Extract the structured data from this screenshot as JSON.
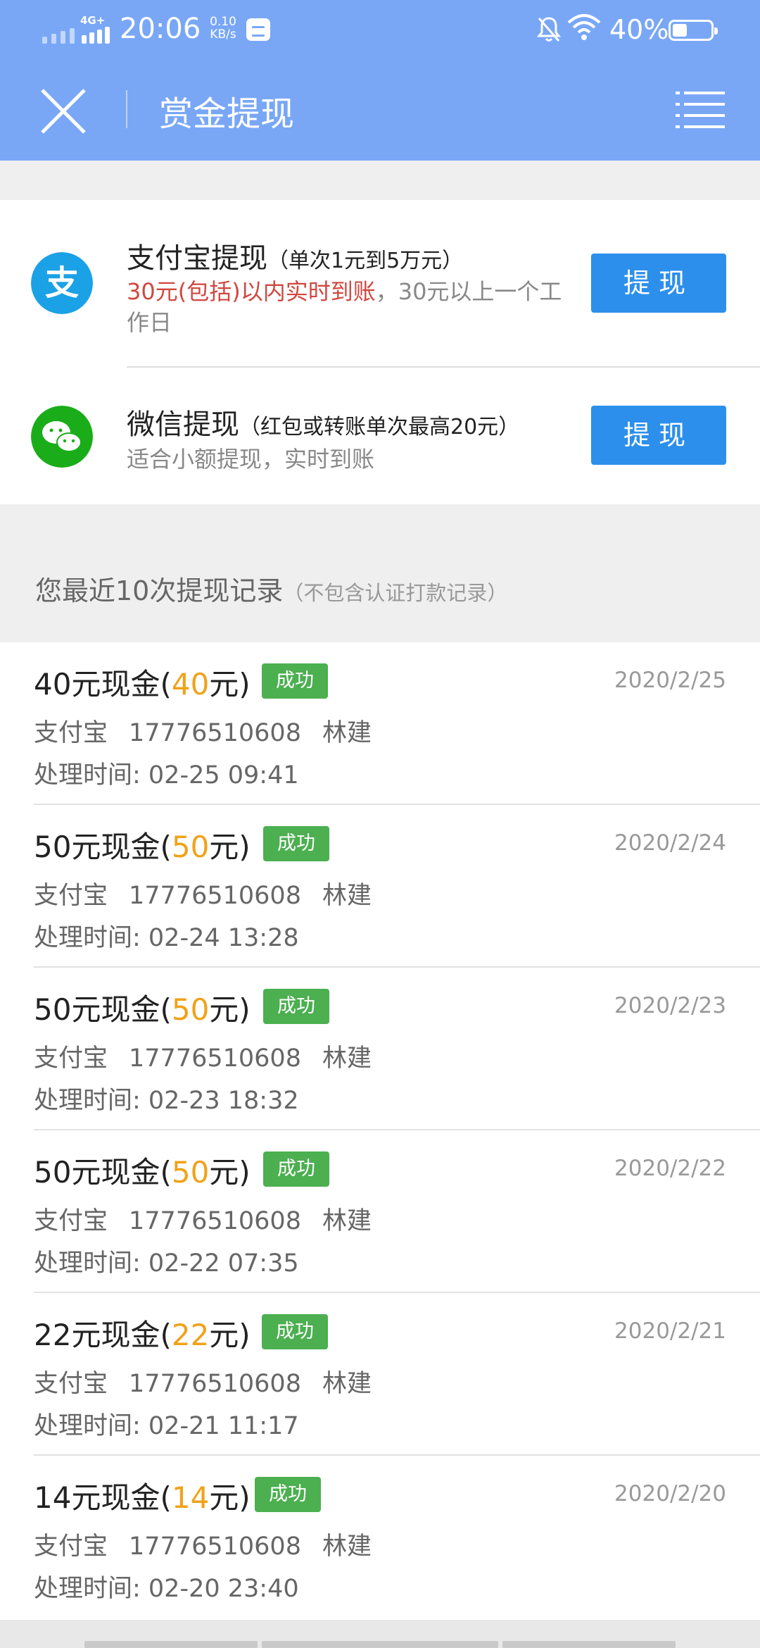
{
  "status_bar": {
    "network": "4G+",
    "time": "20:06",
    "speed_value": "0.10",
    "speed_unit": "KB/s",
    "battery": "40%"
  },
  "header": {
    "title": "赏金提现",
    "close_icon": "close-icon",
    "menu_icon": "menu-icon"
  },
  "options": [
    {
      "icon": "alipay-icon",
      "icon_color": "#1ba1e6",
      "title": "支付宝提现",
      "title_note": "（单次1元到5万元）",
      "desc_highlight": "30元(包括)以内实时到账",
      "desc_rest": "，30元以上一个工作日",
      "button": "提现"
    },
    {
      "icon": "wechat-icon",
      "icon_color": "#1aad19",
      "title": "微信提现",
      "title_note_pre": "（红包或转账单次最高",
      "title_note_highlight": "20元",
      "title_note_post": "）",
      "desc": "适合小额提现，实时到账",
      "button": "提现"
    }
  ],
  "records_section": {
    "title": "您最近10次提现记录",
    "note": "（不包含认证打款记录）"
  },
  "records": [
    {
      "amount": "40元现金(",
      "amount_val": "40",
      "amount_suffix": "元)",
      "status": "成功",
      "date": "2020/2/25",
      "method": "支付宝",
      "account": "17776510608",
      "name": "林建",
      "time": "处理时间: 02-25 09:41"
    },
    {
      "amount": "50元现金(",
      "amount_val": "50",
      "amount_suffix": "元)",
      "status": "成功",
      "date": "2020/2/24",
      "method": "支付宝",
      "account": "17776510608",
      "name": "林建",
      "time": "处理时间: 02-24 13:28"
    },
    {
      "amount": "50元现金(",
      "amount_val": "50",
      "amount_suffix": "元)",
      "status": "成功",
      "date": "2020/2/23",
      "method": "支付宝",
      "account": "17776510608",
      "name": "林建",
      "time": "处理时间: 02-23 18:32"
    },
    {
      "amount": "50元现金(",
      "amount_val": "50",
      "amount_suffix": "元)",
      "status": "成功",
      "date": "2020/2/22",
      "method": "支付宝",
      "account": "17776510608",
      "name": "林建",
      "time": "处理时间: 02-22 07:35"
    },
    {
      "amount": "22元现金(",
      "amount_val": "22",
      "amount_suffix": "元)",
      "status": "成功",
      "date": "2020/2/21",
      "method": "支付宝",
      "account": "17776510608",
      "name": "林建",
      "time": "处理时间: 02-21 11:17"
    },
    {
      "amount": "14元现金(",
      "amount_val": "14",
      "amount_suffix": "元)",
      "status": "成功",
      "date": "2020/2/20",
      "method": "支付宝",
      "account": "17776510608",
      "name": "林建",
      "time": "处理时间: 02-20 23:40"
    }
  ],
  "colors": {
    "header_bg": "#79a7f6",
    "button_blue": "#2c8fec",
    "success_green": "#4caf50",
    "amount_orange": "#f0a219",
    "highlight_red": "#d0473f"
  }
}
